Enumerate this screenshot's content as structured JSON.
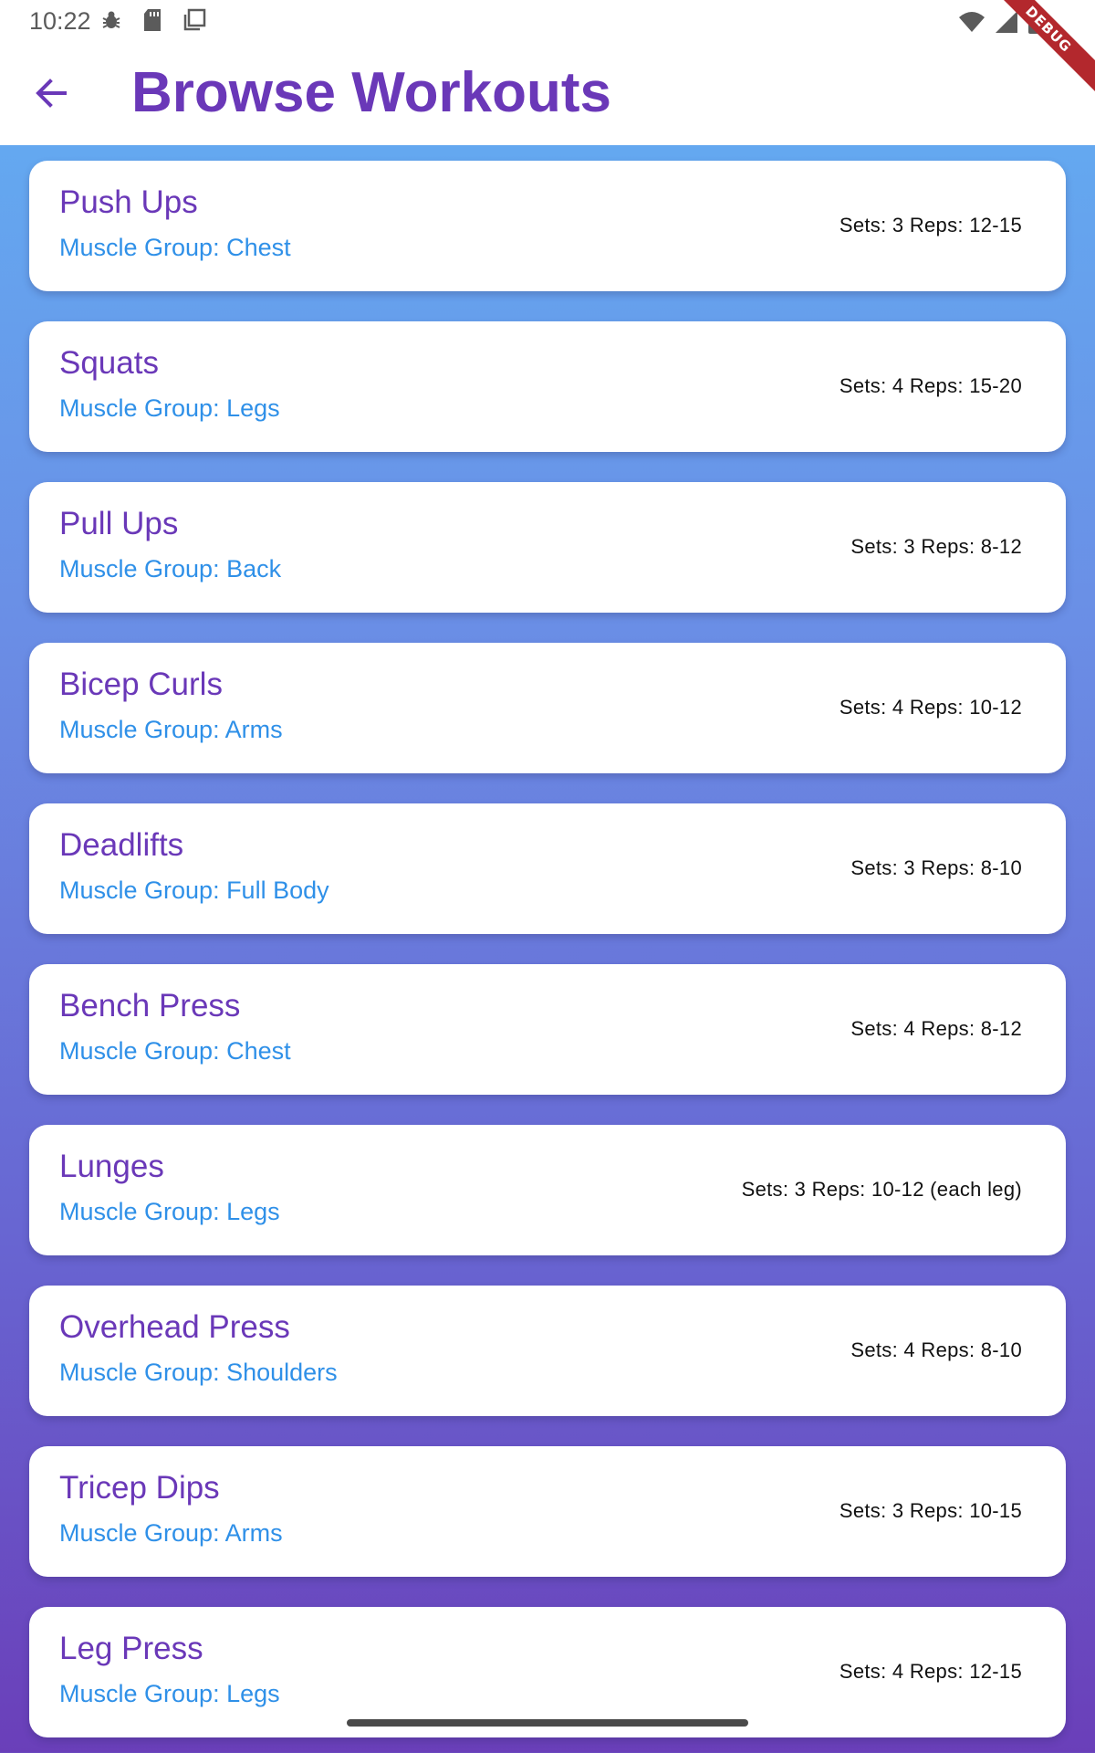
{
  "status_bar": {
    "time": "10:22",
    "debug_banner": "DEBUG"
  },
  "header": {
    "title": "Browse Workouts"
  },
  "workouts": [
    {
      "name": "Push Ups",
      "muscle": "Muscle Group: Chest",
      "sets": "Sets: 3 Reps: 12-15"
    },
    {
      "name": "Squats",
      "muscle": "Muscle Group: Legs",
      "sets": "Sets: 4 Reps: 15-20"
    },
    {
      "name": "Pull Ups",
      "muscle": "Muscle Group: Back",
      "sets": "Sets: 3 Reps: 8-12"
    },
    {
      "name": "Bicep Curls",
      "muscle": "Muscle Group: Arms",
      "sets": "Sets: 4 Reps: 10-12"
    },
    {
      "name": "Deadlifts",
      "muscle": "Muscle Group: Full Body",
      "sets": "Sets: 3 Reps: 8-10"
    },
    {
      "name": "Bench Press",
      "muscle": "Muscle Group: Chest",
      "sets": "Sets: 4 Reps: 8-12"
    },
    {
      "name": "Lunges",
      "muscle": "Muscle Group: Legs",
      "sets": "Sets: 3 Reps: 10-12 (each leg)"
    },
    {
      "name": "Overhead Press",
      "muscle": "Muscle Group: Shoulders",
      "sets": "Sets: 4 Reps: 8-10"
    },
    {
      "name": "Tricep Dips",
      "muscle": "Muscle Group: Arms",
      "sets": "Sets: 3 Reps: 10-15"
    },
    {
      "name": "Leg Press",
      "muscle": "Muscle Group: Legs",
      "sets": "Sets: 4 Reps: 12-15"
    }
  ],
  "colors": {
    "title": "#6a38b8",
    "muscle_group": "#2f90e8",
    "gradient_top": "#62b0f3",
    "gradient_bottom": "#6a3fb9"
  },
  "icons": {
    "back": "arrow-left-icon",
    "status_left": [
      "bug-icon",
      "sd-card-icon",
      "square-stack-icon"
    ],
    "status_right": [
      "wifi-icon",
      "signal-icon",
      "battery-icon"
    ]
  }
}
